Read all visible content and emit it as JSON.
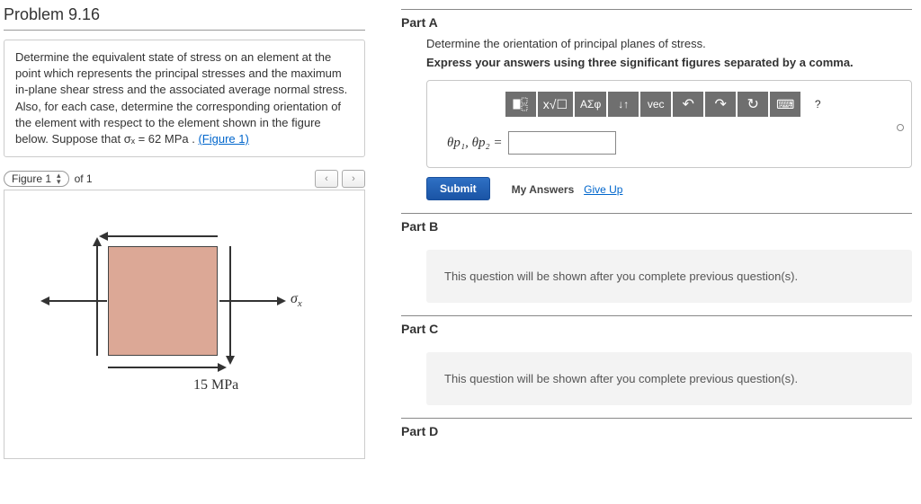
{
  "problem": {
    "title": "Problem 9.16",
    "statement": "Determine the equivalent state of stress on an element at the point which represents the principal stresses and the maximum in-plane shear stress and the associated average normal stress. Also, for each case, determine the corresponding orientation of the element with respect to the element shown in the figure below. Suppose that σₓ = 62 MPa . ",
    "figure_link": "(Figure 1)"
  },
  "figure_bar": {
    "label": "Figure 1",
    "of": "of 1"
  },
  "figure": {
    "sigma_x": "σ",
    "sigma_x_sub": "x",
    "shear_value": "15 MPa"
  },
  "partA": {
    "heading": "Part A",
    "prompt": "Determine the orientation of principal planes of stress.",
    "instruction": "Express your answers using three significant figures separated by a comma.",
    "answer_label": "θp₁, θp₂ =",
    "answer_value": ""
  },
  "toolbar": {
    "template": "tmpl",
    "sqrt": "√",
    "greek": "ΑΣφ",
    "updown": "↓↑",
    "vec": "vec",
    "undo": "↶",
    "redo": "↷",
    "reset": "↻",
    "keyboard": "⌨",
    "help": "?"
  },
  "actions": {
    "submit": "Submit",
    "myanswers": "My Answers",
    "giveup": "Give Up"
  },
  "partB": {
    "heading": "Part B",
    "locked": "This question will be shown after you complete previous question(s)."
  },
  "partC": {
    "heading": "Part C",
    "locked": "This question will be shown after you complete previous question(s)."
  },
  "partD": {
    "heading": "Part D"
  }
}
